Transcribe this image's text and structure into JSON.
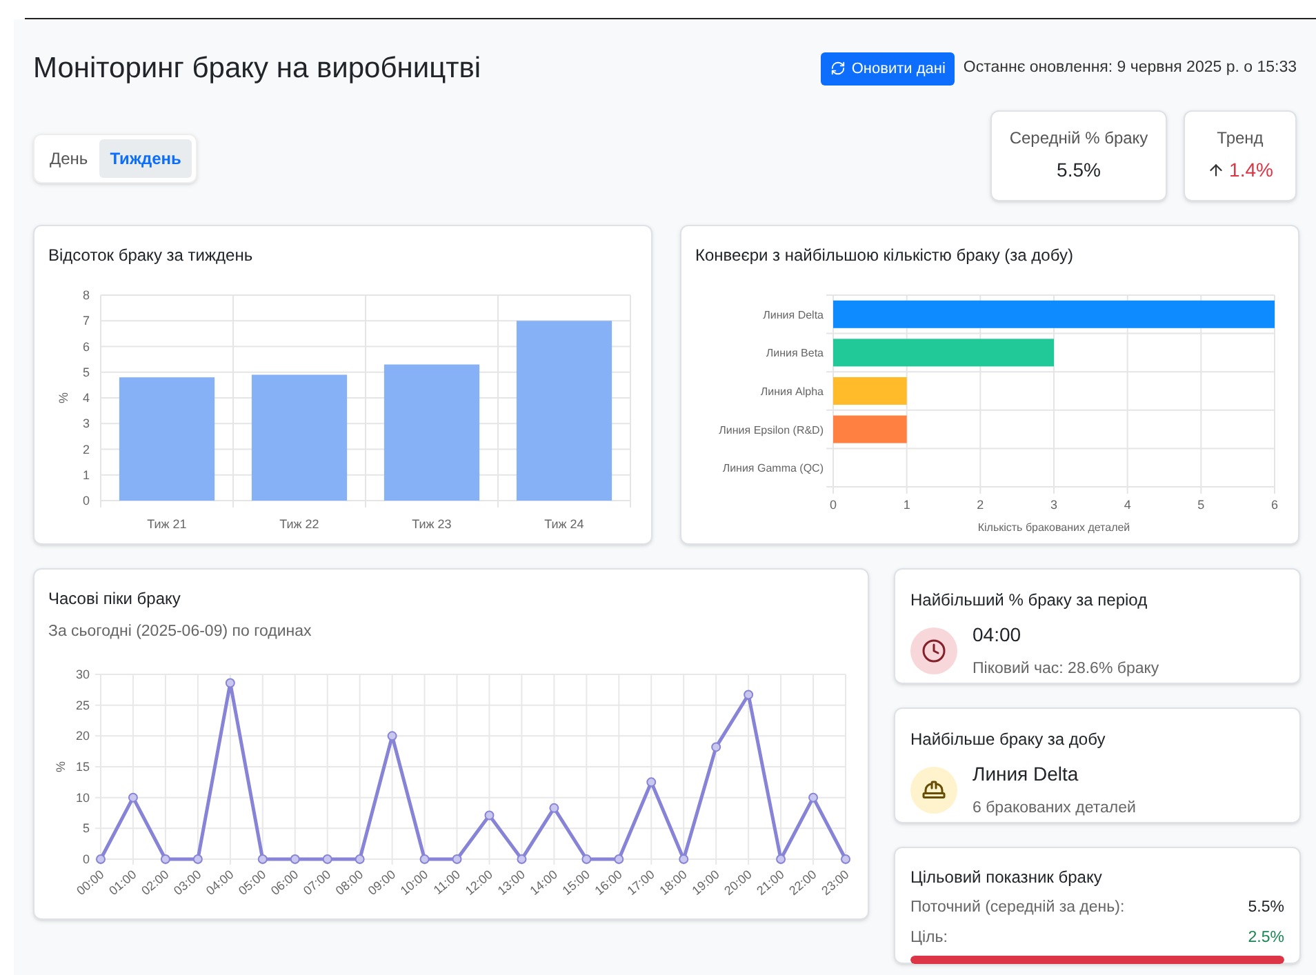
{
  "header": {
    "title": "Моніторинг браку на виробництві",
    "refresh_button": "Оновити дані",
    "last_update": "Останнє оновлення: 9 червня 2025 р. о 15:33"
  },
  "period_tabs": [
    {
      "label": "День",
      "selected": false
    },
    {
      "label": "Тиждень",
      "selected": true
    }
  ],
  "stats": [
    {
      "label": "Середній % браку",
      "value": "5.5%",
      "kind": "plain"
    },
    {
      "label": "Тренд",
      "value": "1.4%",
      "kind": "trend-up"
    }
  ],
  "weekly_chart": {
    "title": "Відсоток браку за тиждень",
    "chart_data": {
      "type": "bar",
      "ylabel": "%",
      "categories": [
        "Тиж 21",
        "Тиж 22",
        "Тиж 23",
        "Тиж 24"
      ],
      "series": [
        {
          "color": "#86b1f7",
          "values": [
            4.8,
            4.9,
            5.3,
            7.0
          ]
        }
      ],
      "grid": true,
      "ylim": [
        0,
        8
      ],
      "yticks": [
        0,
        1,
        2,
        3,
        4,
        5,
        6,
        7,
        8
      ]
    }
  },
  "conveyor_chart": {
    "title": "Конвеєри з найбільшою кількістю браку (за добу)",
    "chart_data": {
      "type": "bar",
      "orientation": "horizontal",
      "xlabel": "Кількість бракованих деталей",
      "categories": [
        "Линия Delta",
        "Линия Beta",
        "Линия Alpha",
        "Линия Epsilon (R&D)",
        "Линия Gamma (QC)"
      ],
      "stacked": true,
      "grid": true,
      "series": [
        {
          "color": "#0d8bff",
          "values": [
            6,
            null,
            null,
            null,
            null
          ]
        },
        {
          "color": "#20c997",
          "values": [
            null,
            3,
            null,
            null,
            null
          ]
        },
        {
          "color": "#ffbb2a",
          "values": [
            null,
            null,
            1,
            null,
            null
          ]
        },
        {
          "color": "#ff8040",
          "values": [
            null,
            null,
            null,
            1,
            null
          ]
        },
        {
          "values": [
            null,
            null,
            null,
            null,
            0
          ]
        }
      ],
      "xlim": [
        0,
        6
      ],
      "xticks": [
        0,
        1,
        2,
        3,
        4,
        5,
        6
      ]
    }
  },
  "hourly_chart": {
    "title": "Часові піки браку",
    "subtitle": "За сьогодні (2025-06-09) по годинах",
    "chart_data": {
      "type": "line",
      "ylabel": "%",
      "categories": [
        "00:00",
        "01:00",
        "02:00",
        "03:00",
        "04:00",
        "05:00",
        "06:00",
        "07:00",
        "08:00",
        "09:00",
        "10:00",
        "11:00",
        "12:00",
        "13:00",
        "14:00",
        "15:00",
        "16:00",
        "17:00",
        "18:00",
        "19:00",
        "20:00",
        "21:00",
        "22:00",
        "23:00"
      ],
      "grid": true,
      "series": [
        {
          "color": "#8784d8",
          "marker": "circle",
          "values": [
            0,
            10,
            0,
            0,
            28.6,
            0,
            0,
            0,
            0,
            20,
            0,
            0,
            7.1,
            0,
            8.3,
            0,
            0,
            12.5,
            0,
            18.2,
            26.7,
            0,
            10,
            0
          ]
        }
      ],
      "ylim": [
        0,
        30
      ],
      "yticks": [
        0,
        5,
        10,
        15,
        20,
        25,
        30
      ]
    }
  },
  "info_cards": [
    {
      "title": "Найбільший % браку за період",
      "value": "04:00",
      "detail": "Піковий час: 28.6% браку",
      "kind": "clock"
    },
    {
      "title": "Найбільше браку за добу",
      "value": "Линия Delta",
      "detail": "6 бракованих деталей",
      "kind": "helmet"
    }
  ],
  "target": {
    "title": "Цільовий показник браку",
    "current_label": "Поточний (середній за день):",
    "current_value": "5.5%",
    "goal_label": "Ціль:",
    "goal_value": "2.5%",
    "level": 1
  }
}
